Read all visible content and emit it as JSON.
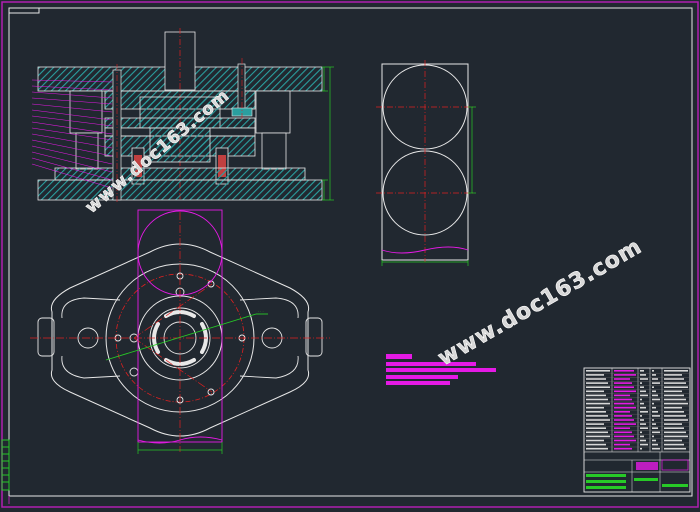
{
  "drawing": {
    "watermark_primary": "www.doc163.com",
    "watermark_secondary": "www.doc163.com"
  },
  "colors": {
    "background": "#212830",
    "frame": "#b01fb0",
    "border": "#e8e8e8",
    "hatch": "#2a9f9f",
    "center_line": "#e02020",
    "green": "#27c927",
    "magenta": "#e51ae5",
    "yellow": "#e6e62a",
    "white": "#ffffff"
  }
}
